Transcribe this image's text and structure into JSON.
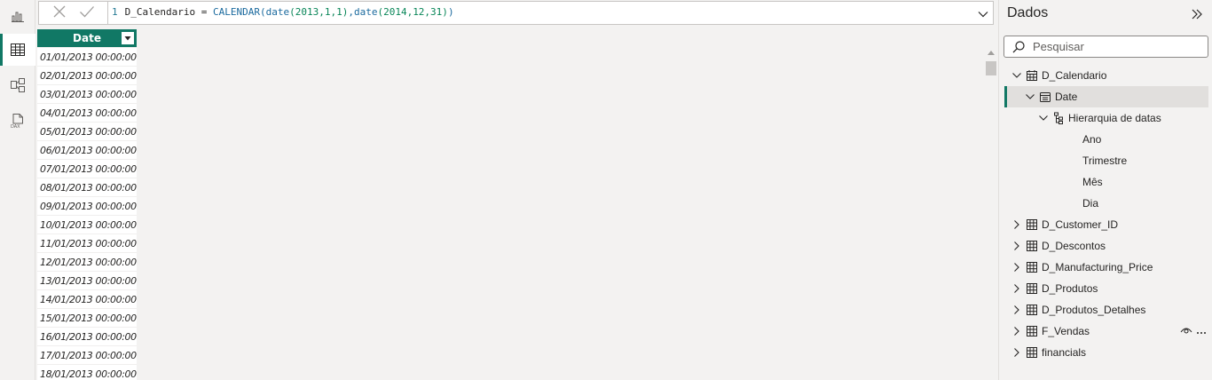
{
  "rail": {
    "items": [
      {
        "name": "report-view",
        "icon": "bar-chart-icon"
      },
      {
        "name": "table-view",
        "icon": "table-icon",
        "active": true
      },
      {
        "name": "model-view",
        "icon": "model-icon"
      },
      {
        "name": "dax-query-view",
        "icon": "dax-icon"
      }
    ]
  },
  "formula": {
    "line_number": "1",
    "table_name": "D_Calendario",
    "equals": " = ",
    "fn_calendar": "CALENDAR",
    "open": "(",
    "fn_date1": "date",
    "args1": "(2013,1,1)",
    "comma": ",",
    "fn_date2": "date",
    "args2": "(2014,12,31)",
    "close": ")"
  },
  "table": {
    "column_header": "Date",
    "rows": [
      "01/01/2013 00:00:00",
      "02/01/2013 00:00:00",
      "03/01/2013 00:00:00",
      "04/01/2013 00:00:00",
      "05/01/2013 00:00:00",
      "06/01/2013 00:00:00",
      "07/01/2013 00:00:00",
      "08/01/2013 00:00:00",
      "09/01/2013 00:00:00",
      "10/01/2013 00:00:00",
      "11/01/2013 00:00:00",
      "12/01/2013 00:00:00",
      "13/01/2013 00:00:00",
      "14/01/2013 00:00:00",
      "15/01/2013 00:00:00",
      "16/01/2013 00:00:00",
      "17/01/2013 00:00:00",
      "18/01/2013 00:00:00"
    ]
  },
  "data_pane": {
    "title": "Dados",
    "search_placeholder": "Pesquisar",
    "tree": [
      {
        "label": "D_Calendario",
        "level": 0,
        "expanded": true,
        "icon": "calendar-table-icon"
      },
      {
        "label": "Date",
        "level": 1,
        "expanded": true,
        "icon": "date-field-icon",
        "selected": true
      },
      {
        "label": "Hierarquia de datas",
        "level": 2,
        "expanded": true,
        "icon": "hierarchy-icon"
      },
      {
        "label": "Ano",
        "level": 3
      },
      {
        "label": "Trimestre",
        "level": 3
      },
      {
        "label": "Mês",
        "level": 3
      },
      {
        "label": "Dia",
        "level": 3
      },
      {
        "label": "D_Customer_ID",
        "level": 0,
        "expanded": false,
        "icon": "table-icon"
      },
      {
        "label": "D_Descontos",
        "level": 0,
        "expanded": false,
        "icon": "table-icon"
      },
      {
        "label": "D_Manufacturing_Price",
        "level": 0,
        "expanded": false,
        "icon": "table-icon"
      },
      {
        "label": "D_Produtos",
        "level": 0,
        "expanded": false,
        "icon": "table-icon"
      },
      {
        "label": "D_Produtos_Detalhes",
        "level": 0,
        "expanded": false,
        "icon": "table-icon"
      },
      {
        "label": "F_Vendas",
        "level": 0,
        "expanded": false,
        "icon": "table-icon",
        "hover_icons": [
          "eye-icon",
          "more-icon"
        ]
      },
      {
        "label": "financials",
        "level": 0,
        "expanded": false,
        "icon": "table-icon"
      }
    ]
  },
  "colors": {
    "accent": "#117865",
    "background": "#f3f2f1",
    "code_function": "#1b6a9e",
    "code_number": "#098658"
  }
}
